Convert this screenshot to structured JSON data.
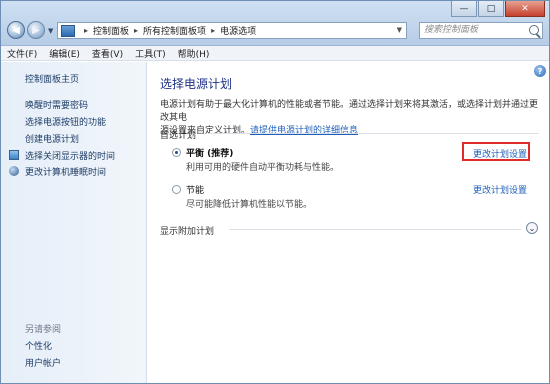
{
  "window": {
    "controls": {
      "minimize": "—",
      "maximize": "□",
      "close": "✕"
    }
  },
  "address": {
    "crumbs": [
      "控制面板",
      "所有控制面板项",
      "电源选项"
    ]
  },
  "search": {
    "placeholder": "搜索控制面板"
  },
  "menubar": {
    "items": [
      "文件(F)",
      "编辑(E)",
      "查看(V)",
      "工具(T)",
      "帮助(H)"
    ]
  },
  "sidebar": {
    "home": "控制面板主页",
    "links": [
      "唤醒时需要密码",
      "选择电源按钮的功能",
      "创建电源计划",
      "选择关闭显示器的时间",
      "更改计算机睡眠时间"
    ],
    "see_also_title": "另请参阅",
    "see_also": [
      "个性化",
      "用户帐户"
    ]
  },
  "main": {
    "title": "选择电源计划",
    "desc_line1": "电源计划有助于最大化计算机的性能或者节能。通过选择计划来将其激活，或选择计划并通过更改其电",
    "desc_line2_prefix": "源设置来自定义计划。",
    "desc_link": "请提供电源计划的详细信息",
    "preferred_label": "首选计划",
    "plans": [
      {
        "name": "平衡 (推荐)",
        "desc": "利用可用的硬件自动平衡功耗与性能。",
        "selected": true,
        "change_link": "更改计划设置"
      },
      {
        "name": "节能",
        "desc": "尽可能降低计算机性能以节能。",
        "selected": false,
        "change_link": "更改计划设置"
      }
    ],
    "more_plans_label": "显示附加计划"
  },
  "icons": {
    "back": "arrow-left-icon",
    "forward": "arrow-right-icon",
    "search": "search-icon",
    "help": "help-icon",
    "expand": "chevron-down-icon"
  },
  "colors": {
    "link": "#1f5fbb",
    "title": "#1e3287",
    "highlight": "#e12a2a"
  }
}
